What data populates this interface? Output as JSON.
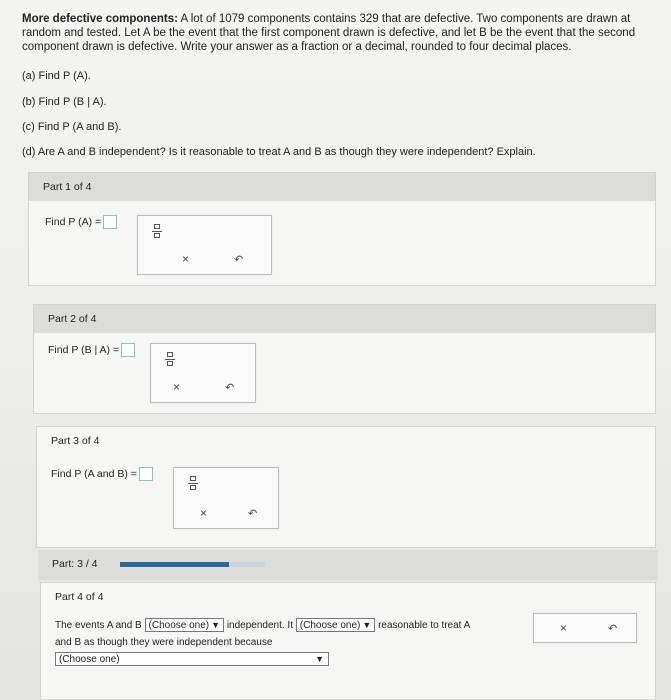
{
  "problem": {
    "title": "More defective components:",
    "line1": " A lot of 1079 components contains 329 that are defective. Two components are drawn at",
    "line2": "random and tested. Let A be the event that the first component drawn is defective, and let B be the event that the second",
    "line3": "component drawn is defective. Write your answer as a fraction or a decimal, rounded to four decimal places."
  },
  "questions": {
    "a": "(a) Find P (A).",
    "b": "(b) Find P (B | A).",
    "c": "(c) Find P (A and B).",
    "d": "(d) Are A and B independent? Is it reasonable to treat A and B as though they were independent? Explain."
  },
  "parts": [
    {
      "header": "Part 1 of 4",
      "prompt": "Find P (A) ="
    },
    {
      "header": "Part 2 of 4",
      "prompt": "Find P (B | A) ="
    },
    {
      "header": "Part 3 of 4",
      "prompt": "Find P (A and B) ="
    },
    {
      "header": "Part 4 of 4"
    }
  ],
  "progress": {
    "label": "Part: 3 / 4",
    "fraction": 0.75
  },
  "part4": {
    "text1": "The events A and B",
    "select1": "(Choose one)",
    "text2": "independent. It",
    "select2": "(Choose one)",
    "text3": "reasonable to treat A",
    "text4": "and B as though they were independent because",
    "select3": "(Choose one)"
  },
  "tools": {
    "clear": "×",
    "undo": "↶"
  },
  "icons": {
    "fraction": "fraction-template-icon",
    "dropdown": "triangle-down-icon"
  }
}
